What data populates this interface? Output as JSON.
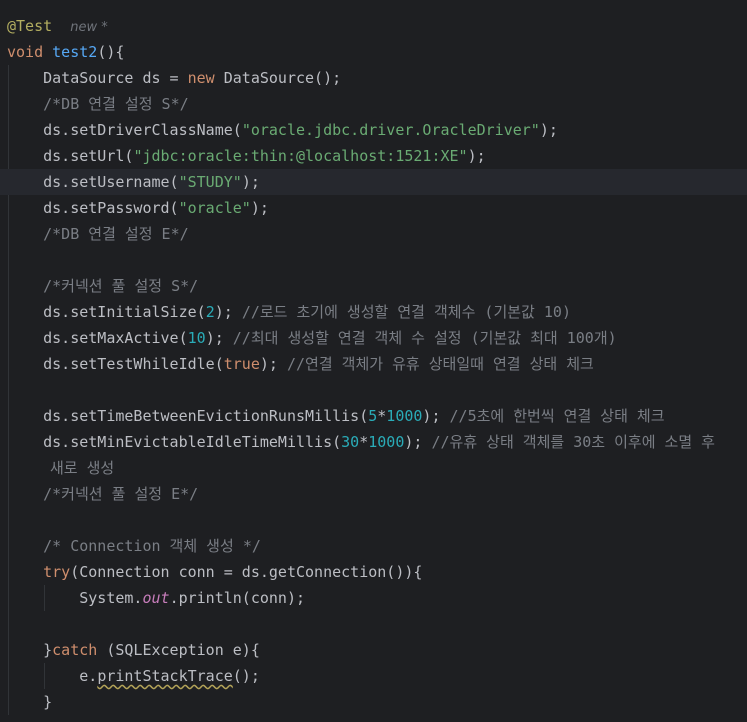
{
  "editor": {
    "author_hint": "new *",
    "lines": [
      [
        [
          "ann",
          "@Test"
        ],
        [
          "plain",
          "  "
        ],
        [
          "hint",
          "new *"
        ]
      ],
      [
        [
          "kw",
          "void "
        ],
        [
          "fn",
          "test2"
        ],
        [
          "plain",
          "(){"
        ]
      ],
      [
        [
          "plain",
          "    DataSource ds = "
        ],
        [
          "kw",
          "new "
        ],
        [
          "plain",
          "DataSource();"
        ]
      ],
      [
        [
          "plain",
          "    "
        ],
        [
          "cmt",
          "/*DB 연결 설정 S*/"
        ]
      ],
      [
        [
          "plain",
          "    ds.setDriverClassName("
        ],
        [
          "str",
          "\"oracle.jdbc.driver.OracleDriver\""
        ],
        [
          "plain",
          ");"
        ]
      ],
      [
        [
          "plain",
          "    ds.setUrl("
        ],
        [
          "str",
          "\"jdbc:oracle:thin:@localhost:1521:XE\""
        ],
        [
          "plain",
          ");"
        ]
      ],
      [
        [
          "plain",
          "    ds.setUsername("
        ],
        [
          "str",
          "\"STUDY\""
        ],
        [
          "plain",
          ");"
        ]
      ],
      [
        [
          "plain",
          "    ds.setPassword("
        ],
        [
          "str",
          "\"oracle\""
        ],
        [
          "plain",
          ");"
        ]
      ],
      [
        [
          "plain",
          "    "
        ],
        [
          "cmt",
          "/*DB 연결 설정 E*/"
        ]
      ],
      [],
      [
        [
          "plain",
          "    "
        ],
        [
          "cmt",
          "/*커넥션 풀 설정 S*/"
        ]
      ],
      [
        [
          "plain",
          "    ds.setInitialSize("
        ],
        [
          "num",
          "2"
        ],
        [
          "plain",
          "); "
        ],
        [
          "cmt",
          "//로드 초기에 생성할 연결 객체수 (기본값 10)"
        ]
      ],
      [
        [
          "plain",
          "    ds.setMaxActive("
        ],
        [
          "num",
          "10"
        ],
        [
          "plain",
          "); "
        ],
        [
          "cmt",
          "//최대 생성할 연결 객체 수 설정 (기본값 최대 100개)"
        ]
      ],
      [
        [
          "plain",
          "    ds.setTestWhileIdle("
        ],
        [
          "kw",
          "true"
        ],
        [
          "plain",
          "); "
        ],
        [
          "cmt",
          "//연결 객체가 유휴 상태일때 연결 상태 체크"
        ]
      ],
      [],
      [
        [
          "plain",
          "    ds.setTimeBetweenEvictionRunsMillis("
        ],
        [
          "num",
          "5"
        ],
        [
          "plain",
          "*"
        ],
        [
          "num",
          "1000"
        ],
        [
          "plain",
          "); "
        ],
        [
          "cmt",
          "//5초에 한번씩 연결 상태 체크"
        ]
      ],
      [
        [
          "plain",
          "    ds.setMinEvictableIdleTimeMillis("
        ],
        [
          "num",
          "30"
        ],
        [
          "plain",
          "*"
        ],
        [
          "num",
          "1000"
        ],
        [
          "plain",
          "); "
        ],
        [
          "cmt",
          "//유휴 상태 객체를 30초 이후에 소멸 후"
        ]
      ],
      [
        [
          "cmt",
          "새로 생성"
        ]
      ],
      [
        [
          "plain",
          "    "
        ],
        [
          "cmt",
          "/*커넥션 풀 설정 E*/"
        ]
      ],
      [],
      [
        [
          "plain",
          "    "
        ],
        [
          "cmt",
          "/* Connection 객체 생성 */"
        ]
      ],
      [
        [
          "plain",
          "    "
        ],
        [
          "kw",
          "try"
        ],
        [
          "plain",
          "(Connection conn = ds.getConnection()){"
        ]
      ],
      [
        [
          "plain",
          "        System."
        ],
        [
          "static",
          "out"
        ],
        [
          "plain",
          ".println(conn);"
        ]
      ],
      [],
      [
        [
          "plain",
          "    }"
        ],
        [
          "kw",
          "catch "
        ],
        [
          "plain",
          "(SQLException e){"
        ]
      ],
      [
        [
          "plain",
          "        e."
        ],
        [
          "warn",
          "printStackTrace"
        ],
        [
          "plain",
          "();"
        ]
      ],
      [
        [
          "plain",
          "    }"
        ]
      ]
    ],
    "current_line_index": 6,
    "wrap_line_index": 17
  }
}
